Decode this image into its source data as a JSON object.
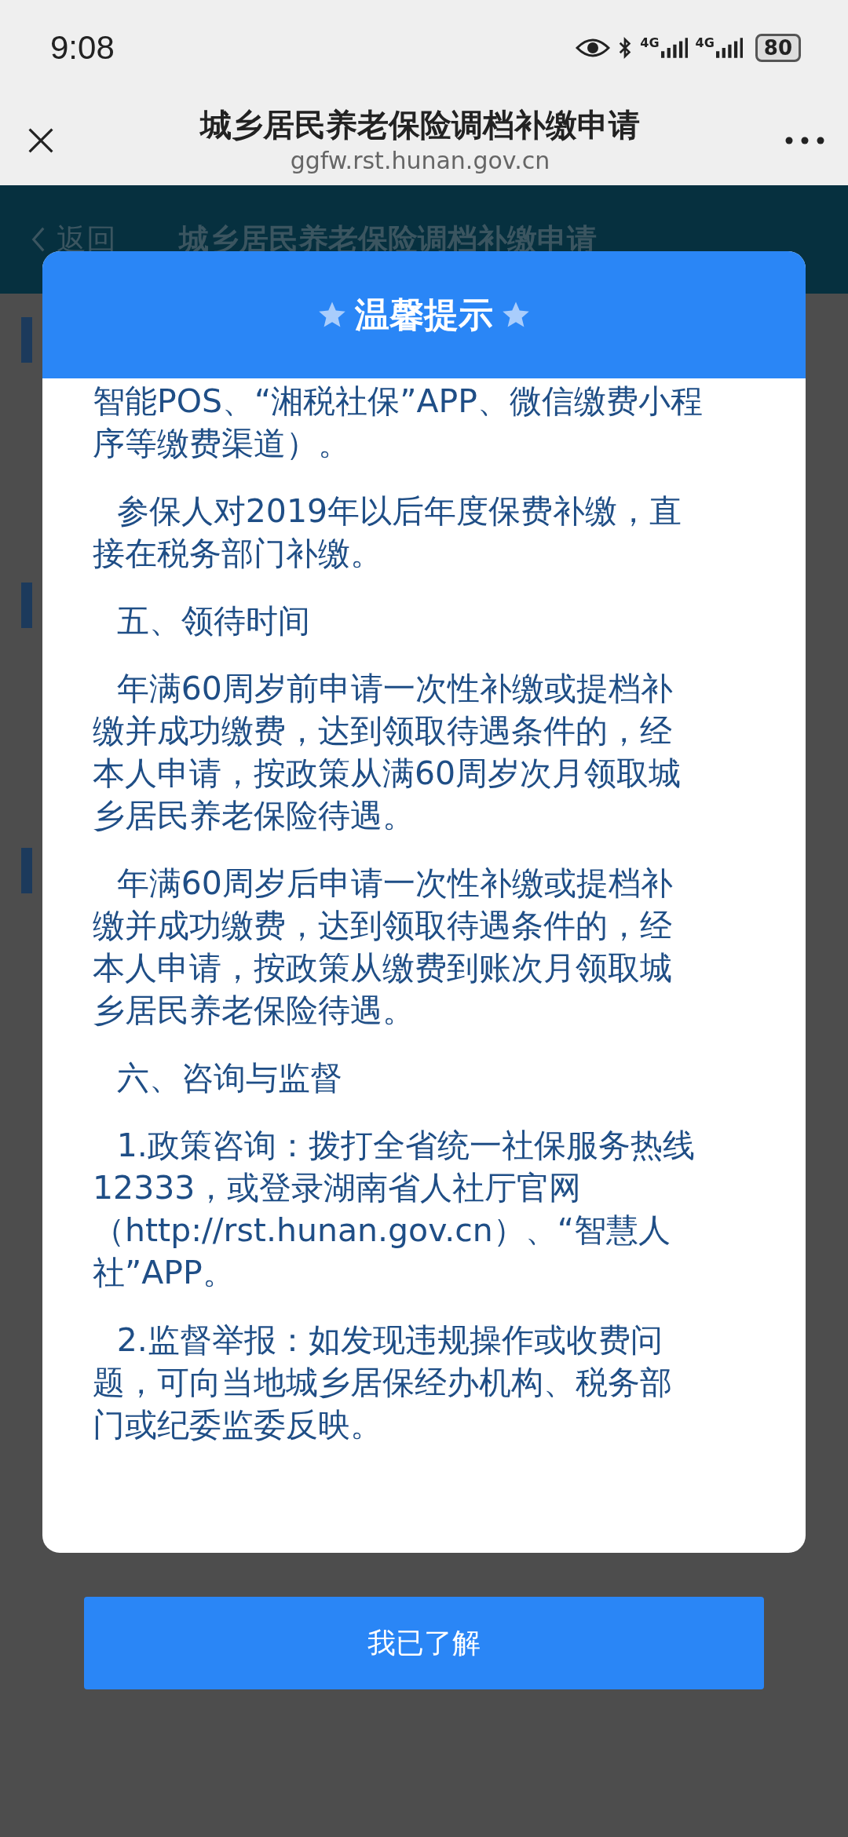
{
  "status_bar": {
    "time": "9:08",
    "networks": [
      "4G",
      "4G"
    ],
    "battery": "80"
  },
  "browser_bar": {
    "title": "城乡居民养老保险调档补缴申请",
    "url": "ggfw.rst.hunan.gov.cn"
  },
  "page_header": {
    "back": "返回",
    "title": "城乡居民养老保险调档补缴申请"
  },
  "dialog": {
    "title": "温馨提示",
    "paragraphs": [
      {
        "text": "智能POS、“湘税社保”APP、微信缴费小程序等缴费渠道）。",
        "indent": false
      },
      {
        "text": "参保人对2019年以后年度保费补缴，直接在税务部门补缴。",
        "indent": true
      },
      {
        "text": "五、领待时间",
        "indent": true
      },
      {
        "text": "年满60周岁前申请一次性补缴或提档补缴并成功缴费，达到领取待遇条件的，经本人申请，按政策从满60周岁次月领取城乡居民养老保险待遇。",
        "indent": true
      },
      {
        "text": "年满60周岁后申请一次性补缴或提档补缴并成功缴费，达到领取待遇条件的，经本人申请，按政策从缴费到账次月领取城乡居民养老保险待遇。",
        "indent": true
      },
      {
        "text": "六、咨询与监督",
        "indent": true
      },
      {
        "text": "1.政策咨询：拨打全省统一社保服务热线12333，或登录湖南省人社厅官网（http://rst.hunan.gov.cn）、“智慧人社”APP。",
        "indent": true
      },
      {
        "text": "2.监督举报：如发现违规操作或收费问题，可向当地城乡居保经办机构、税务部门或纪委监委反映。",
        "indent": true
      }
    ],
    "confirm_button": "我已了解"
  }
}
